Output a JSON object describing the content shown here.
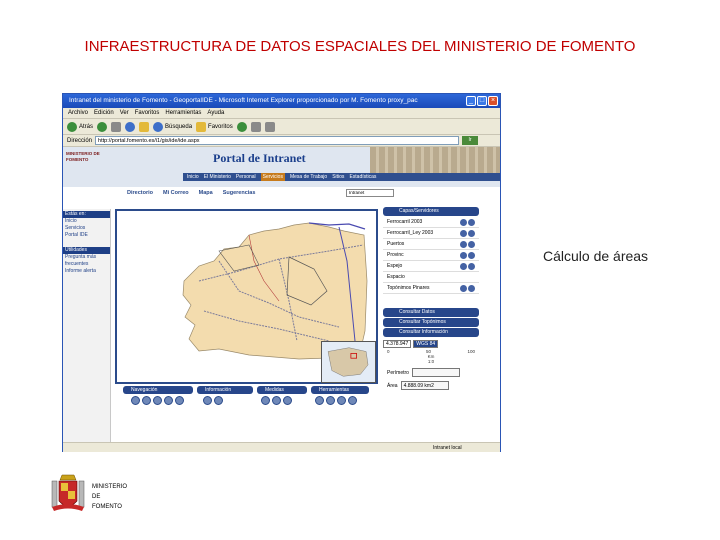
{
  "slide": {
    "title": "INFRAESTRUCTURA DE DATOS ESPACIALES DEL MINISTERIO DE FOMENTO",
    "caption": "Cálculo de áreas"
  },
  "browser": {
    "window_title": "Intranet del ministerio de Fomento - GeoportalIDE - Microsoft Internet Explorer proporcionado por M. Fomento proxy_pac",
    "menu": [
      "Archivo",
      "Edición",
      "Ver",
      "Favoritos",
      "Herramientas",
      "Ayuda"
    ],
    "toolbar": {
      "back": "Atrás",
      "search": "Búsqueda",
      "favorites": "Favoritos"
    },
    "address_label": "Dirección",
    "address_value": "http://portal.fomento.es/i1/gis/ide/ide.aspx",
    "go_label": "Ir",
    "links_label": "Vínculos",
    "status_text": "Intranet local"
  },
  "portal": {
    "logo_text": "MINISTERIO DE FOMENTO",
    "title": "Portal de Intranet",
    "nav": [
      "Inicio",
      "El Ministerio",
      "Personal",
      "Servicios",
      "Mesa de Trabajo",
      "Sitios",
      "Estadísticas"
    ],
    "active_nav": "Servicios",
    "subnav": [
      "Directorio",
      "Mi Correo",
      "Mapa",
      "Sugerencias"
    ],
    "search_value": "Intranet",
    "left_sections": [
      {
        "head": "Estás en:",
        "items": [
          "Inicio",
          "Servicios",
          "Portal IDE"
        ]
      },
      {
        "head": "Utilidades",
        "items": [
          "Pregunta más",
          "frecuentes",
          "Informe alerta"
        ]
      }
    ]
  },
  "viewer": {
    "tool_groups": [
      "Navegación",
      "Información",
      "Medidas",
      "Herramientas"
    ],
    "panels": [
      "Capas/Servidores",
      "Consultar Datos",
      "Consultar Topónimos",
      "Consultar Información"
    ],
    "layers": [
      "Ferrocarril 2003",
      "Ferrocarril_Ley 2003",
      "Puertos",
      "Provinc",
      "Espejo",
      "Espacio",
      "Topónimos Pinares"
    ],
    "coord_value": "4.378.947",
    "projection": "WGS 84",
    "scale_ticks": [
      "0",
      "50",
      "100"
    ],
    "scale_unit": "Km",
    "scale_ratio": "1:0",
    "perimeter_label": "Perímetro",
    "perimeter_value": "",
    "area_label": "Área",
    "area_value": "4.888.09 km2"
  },
  "colors": {
    "title": "#c00000",
    "window_border": "#2a55b5",
    "portal_blue": "#27468a",
    "land": "#f3dcae",
    "sea": "#ffffff"
  },
  "logo": {
    "lines": [
      "MINISTERIO",
      "DE",
      "FOMENTO"
    ]
  }
}
